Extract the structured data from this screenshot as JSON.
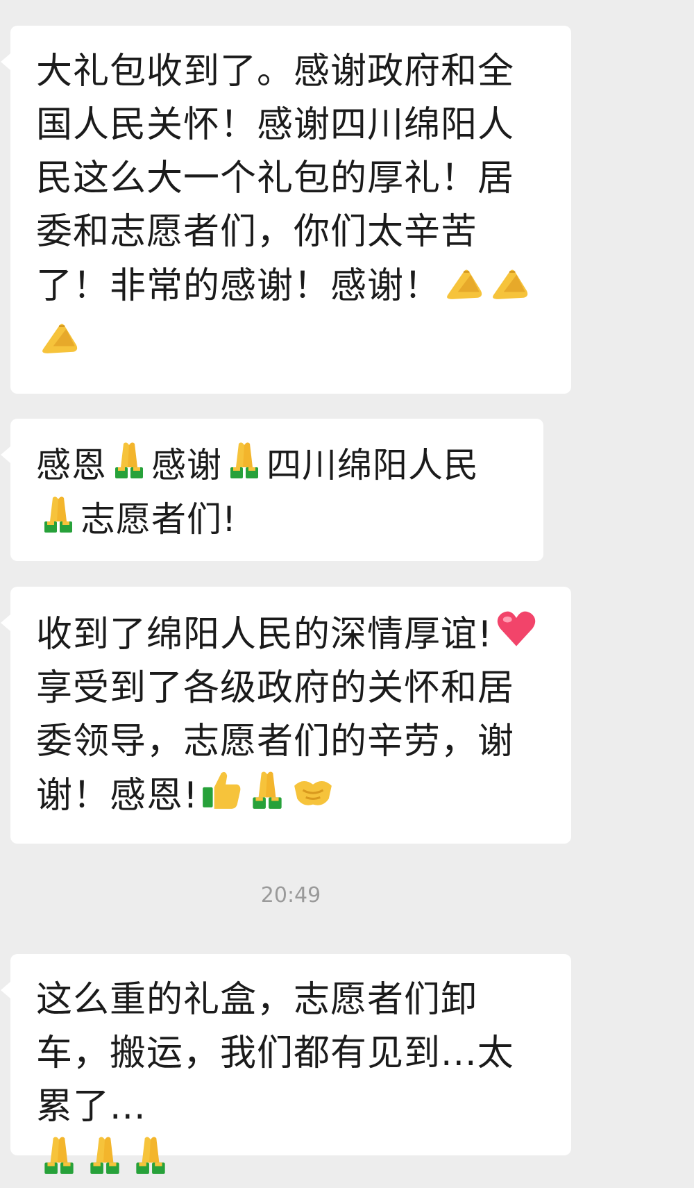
{
  "messages": [
    {
      "text": "大礼包收到了。感谢政府和全国人民关怀！感谢四川绵阳人民这么大一个礼包的厚礼！居委和志愿者们，你们太辛苦了！非常的感谢！感谢！",
      "emojis": [
        "ok-hand-icon",
        "ok-hand-icon",
        "ok-hand-icon"
      ]
    },
    {
      "parts": [
        "感恩",
        "感谢",
        "四川绵阳人民",
        "志愿者们!"
      ],
      "emoji": "folded-hands-icon"
    },
    {
      "text": "收到了绵阳人民的深情厚谊!",
      "text2": "享受到了各级政府的关怀和居委领导，志愿者们的辛劳，谢谢！感恩!",
      "emojis": [
        "red-heart-icon",
        "thumbs-up-icon",
        "folded-hands-icon",
        "handshake-icon"
      ]
    },
    {
      "text": "这么重的礼盒，志愿者们卸车，搬运，我们都有见到...太累了...",
      "emojis": [
        "folded-hands-icon",
        "folded-hands-icon",
        "folded-hands-icon"
      ]
    }
  ],
  "timestamp": "20:49",
  "colors": {
    "background": "#ededed",
    "bubble": "#ffffff",
    "text": "#1b1b1b",
    "timestamp": "#9a9a9a"
  }
}
